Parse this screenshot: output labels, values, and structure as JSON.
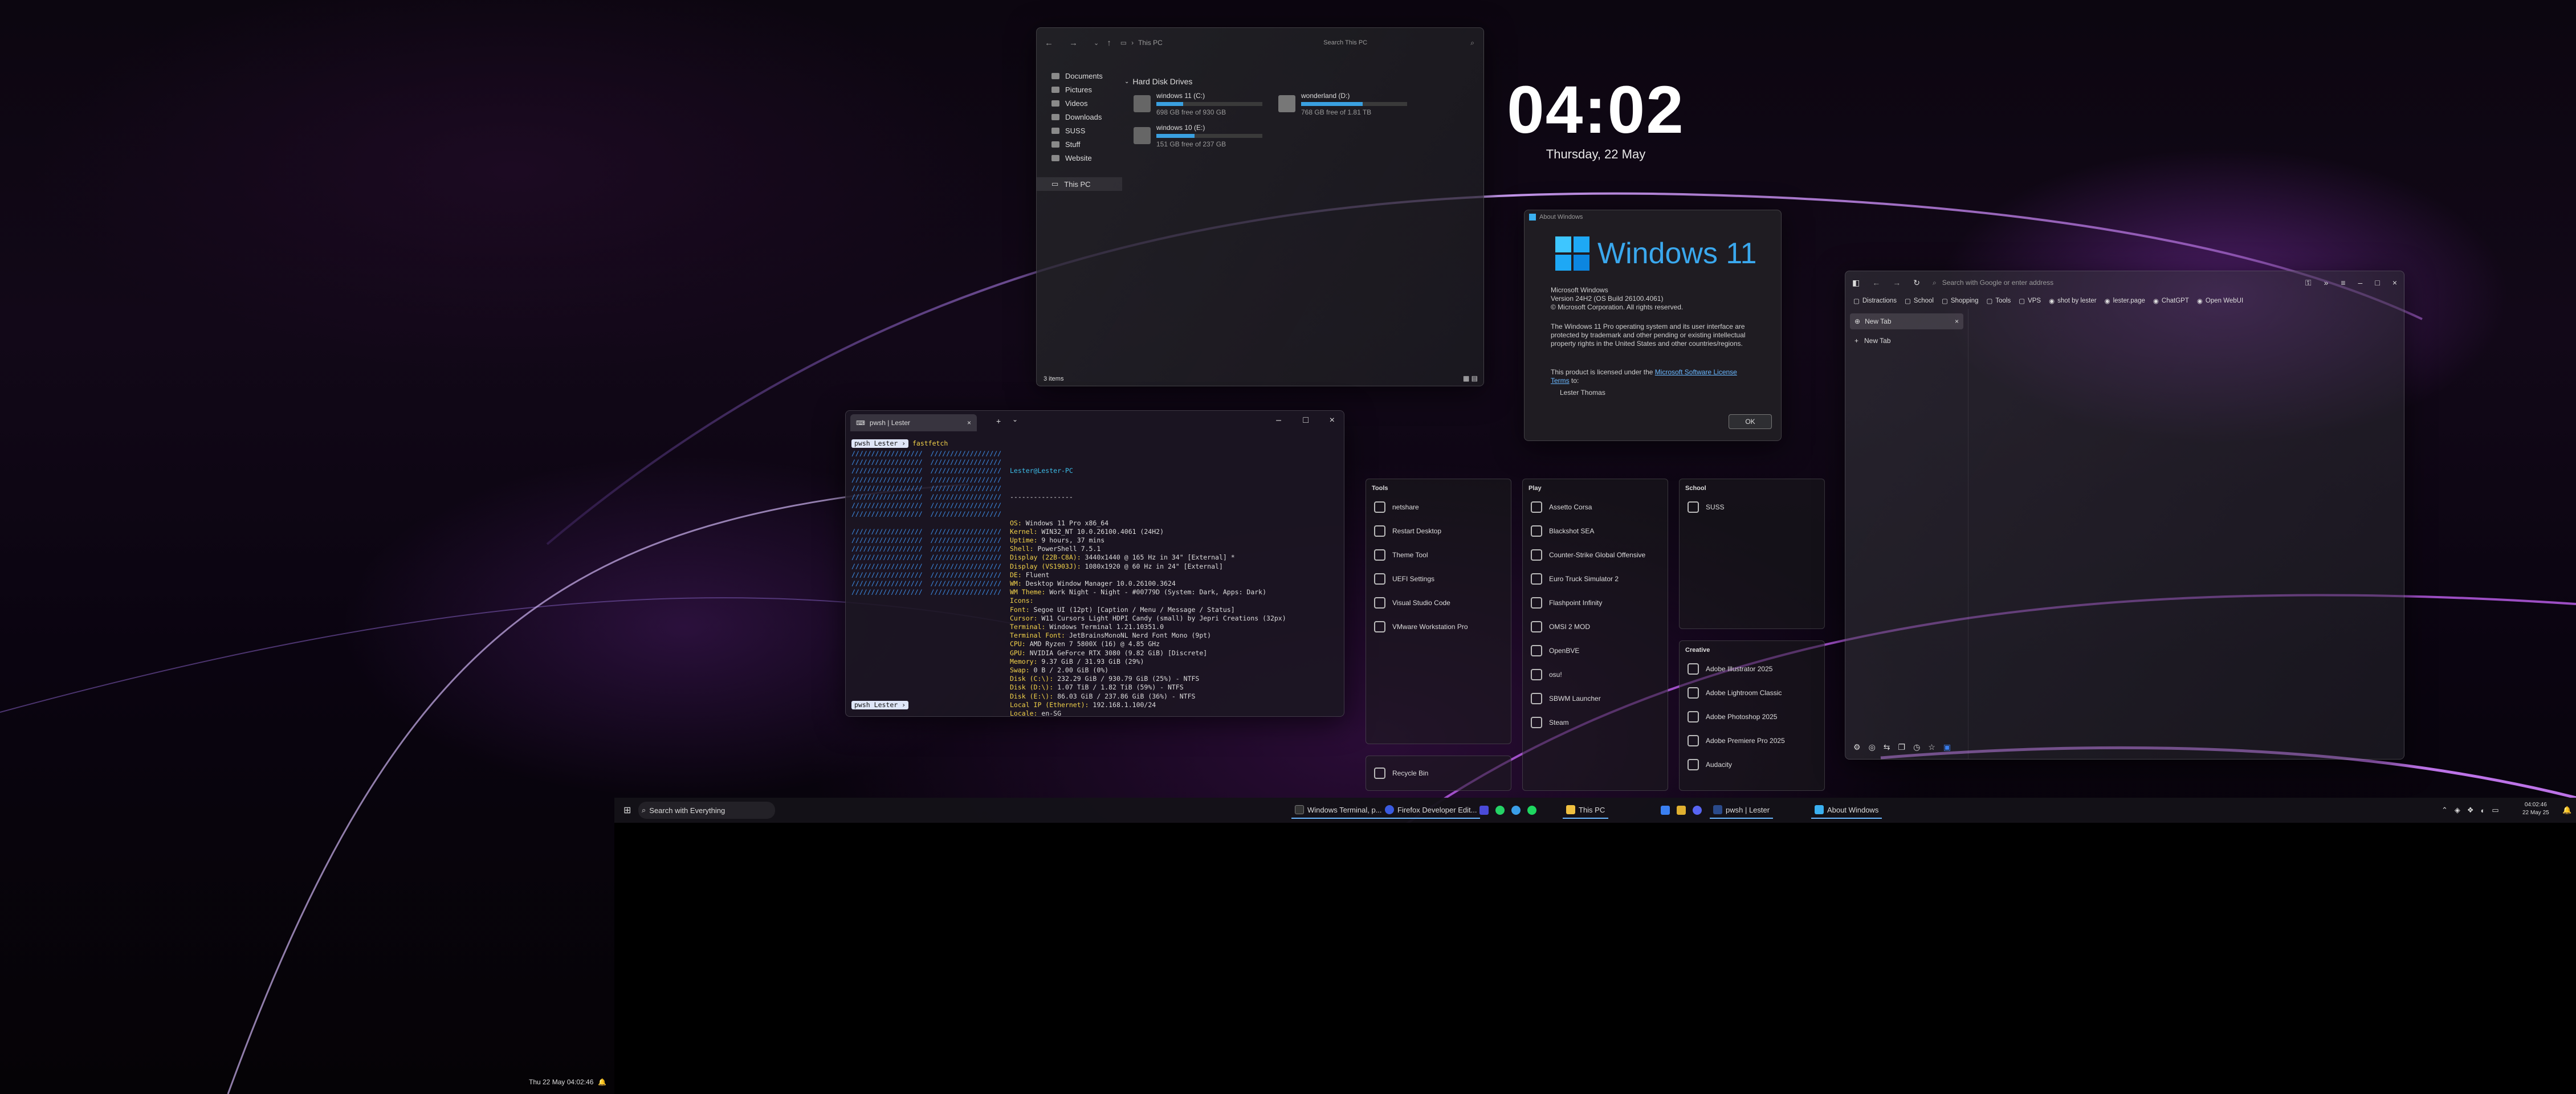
{
  "clock": {
    "time": "04:02",
    "date": "Thursday, 22 May"
  },
  "explorer": {
    "breadcrumb": "This PC",
    "search_placeholder": "Search This PC",
    "sidebar": [
      "Documents",
      "Pictures",
      "Videos",
      "Downloads",
      "SUSS",
      "Stuff",
      "Website"
    ],
    "this_pc": "This PC",
    "section": "Hard Disk Drives",
    "drives": [
      {
        "name": "windows 11 (C:)",
        "free": "698 GB free of 930 GB",
        "used": 0.25
      },
      {
        "name": "wonderland (D:)",
        "free": "768 GB free of 1.81 TB",
        "used": 0.58
      },
      {
        "name": "windows 10 (E:)",
        "free": "151 GB free of 237 GB",
        "used": 0.36
      }
    ],
    "status": "3 items"
  },
  "terminal": {
    "tab_title": "pwsh | Lester",
    "prompt": "pwsh",
    "user": "Lester",
    "command": "fastfetch",
    "host": "Lester@Lester-PC",
    "separator": "----------------",
    "info": [
      {
        "k": "OS",
        "v": "Windows 11 Pro x86_64"
      },
      {
        "k": "Kernel",
        "v": "WIN32_NT 10.0.26100.4061 (24H2)"
      },
      {
        "k": "Uptime",
        "v": "9 hours, 37 mins"
      },
      {
        "k": "Shell",
        "v": "PowerShell 7.5.1"
      },
      {
        "k": "Display (22B-C8A)",
        "v": "3440x1440 @ 165 Hz in 34\" [External] *"
      },
      {
        "k": "Display (VS1903J)",
        "v": "1080x1920 @ 60 Hz in 24\" [External]"
      },
      {
        "k": "DE",
        "v": "Fluent"
      },
      {
        "k": "WM",
        "v": "Desktop Window Manager 10.0.26100.3624"
      },
      {
        "k": "WM Theme",
        "v": "Work Night - Night - #00779D (System: Dark, Apps: Dark)"
      },
      {
        "k": "Icons",
        "v": ""
      },
      {
        "k": "Font",
        "v": "Segoe UI (12pt) [Caption / Menu / Message / Status]"
      },
      {
        "k": "Cursor",
        "v": "W11 Cursors Light HDPI Candy (small) by Jepri Creations (32px)"
      },
      {
        "k": "Terminal",
        "v": "Windows Terminal 1.21.10351.0"
      },
      {
        "k": "Terminal Font",
        "v": "JetBrainsMonoNL Nerd Font Mono (9pt)"
      },
      {
        "k": "CPU",
        "v": "AMD Ryzen 7 5800X (16) @ 4.85 GHz"
      },
      {
        "k": "GPU",
        "v": "NVIDIA GeForce RTX 3080 (9.82 GiB) [Discrete]"
      },
      {
        "k": "Memory",
        "v": "9.37 GiB / 31.93 GiB (29%)"
      },
      {
        "k": "Swap",
        "v": "0 B / 2.00 GiB (0%)"
      },
      {
        "k": "Disk (C:\\)",
        "v": "232.29 GiB / 930.79 GiB (25%) - NTFS"
      },
      {
        "k": "Disk (D:\\)",
        "v": "1.07 TiB / 1.82 TiB (59%) - NTFS"
      },
      {
        "k": "Disk (E:\\)",
        "v": "86.03 GiB / 237.86 GiB (36%) - NTFS"
      },
      {
        "k": "Local IP (Ethernet)",
        "v": "192.168.1.100/24"
      },
      {
        "k": "Locale",
        "v": "en-SG"
      }
    ],
    "palette": [
      "#3a3a3a",
      "#d84a4a",
      "#9ad35a",
      "#e8d44a",
      "#4a8ee8",
      "#b45ad8",
      "#4ad8d8",
      "#e8e8e8"
    ]
  },
  "about": {
    "title": "About Windows",
    "brand": "Windows 11",
    "lines": [
      "Microsoft Windows",
      "Version 24H2 (OS Build 26100.4061)",
      "© Microsoft Corporation. All rights reserved.",
      "The Windows 11 Pro operating system and its user interface are",
      "protected by trademark and other pending or existing intellectual",
      "property rights in the United States and other countries/regions.",
      "This product is licensed under the",
      "Microsoft Software License",
      "Terms",
      "to:",
      "Lester Thomas"
    ],
    "ok": "OK"
  },
  "start": {
    "tools": {
      "title": "Tools",
      "items": [
        "netshare",
        "Restart Desktop",
        "Theme Tool",
        "UEFI Settings",
        "Visual Studio Code",
        "VMware Workstation Pro"
      ]
    },
    "play": {
      "title": "Play",
      "items": [
        "Assetto Corsa",
        "Blackshot SEA",
        "Counter-Strike Global Offensive",
        "Euro Truck Simulator 2",
        "Flashpoint Infinity",
        "OMSI 2 MOD",
        "OpenBVE",
        "osu!",
        "SBWM Launcher",
        "Steam"
      ]
    },
    "school": {
      "title": "School",
      "items": [
        "SUSS"
      ]
    },
    "creative": {
      "title": "Creative",
      "items": [
        "Adobe Illustrator 2025",
        "Adobe Lightroom Classic",
        "Adobe Photoshop 2025",
        "Adobe Premiere Pro 2025",
        "Audacity"
      ]
    },
    "recycle": "Recycle Bin"
  },
  "browser": {
    "url_placeholder": "Search with Google or enter address",
    "bookmarks": [
      "Distractions",
      "School",
      "Shopping",
      "Tools",
      "VPS",
      "shot by lester",
      "lester.page",
      "ChatGPT",
      "Open WebUI"
    ],
    "tab": "New Tab",
    "new_tab": "New Tab"
  },
  "taskbar": {
    "search": "Search with Everything",
    "apps": [
      "Windows Terminal, p...",
      "Firefox Developer Edit...",
      "This PC",
      "pwsh | Lester",
      "About Windows"
    ],
    "time": "04:02:46",
    "date": "22 May 25"
  },
  "secondary": {
    "datetime": "Thu 22 May  04:02:46"
  }
}
